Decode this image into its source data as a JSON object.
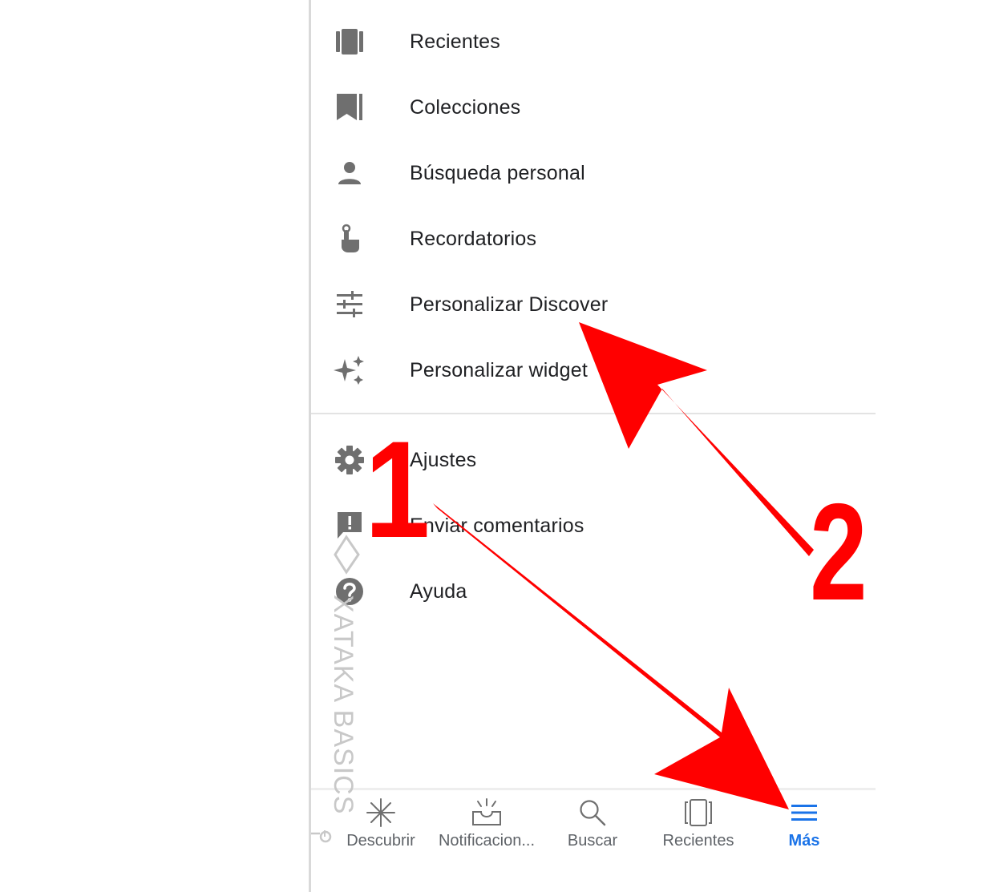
{
  "menu": {
    "items": [
      {
        "label": "Recientes",
        "icon": "recents-icon"
      },
      {
        "label": "Colecciones",
        "icon": "bookmark-icon"
      },
      {
        "label": "Búsqueda personal",
        "icon": "person-icon"
      },
      {
        "label": "Recordatorios",
        "icon": "reminder-icon"
      },
      {
        "label": "Personalizar Discover",
        "icon": "tune-icon"
      },
      {
        "label": "Personalizar widget",
        "icon": "sparkle-icon"
      }
    ],
    "secondary": [
      {
        "label": "Ajustes",
        "icon": "gear-icon"
      },
      {
        "label": "Enviar comentarios",
        "icon": "feedback-icon"
      },
      {
        "label": "Ayuda",
        "icon": "help-icon"
      }
    ]
  },
  "bottom_nav": {
    "items": [
      {
        "label": "Descubrir",
        "icon": "asterisk-icon"
      },
      {
        "label": "Notificacion...",
        "icon": "inbox-icon"
      },
      {
        "label": "Buscar",
        "icon": "search-icon"
      },
      {
        "label": "Recientes",
        "icon": "recents-icon"
      },
      {
        "label": "Más",
        "icon": "menu-icon",
        "active": true
      }
    ]
  },
  "annotations": {
    "marker_1": "1",
    "marker_2": "2",
    "arrow_color": "#ff0000"
  },
  "watermark": {
    "text": "XATAKA BASICS"
  },
  "colors": {
    "accent": "#1a73e8",
    "icon_gray": "#6f6f6f",
    "text": "#202124"
  }
}
